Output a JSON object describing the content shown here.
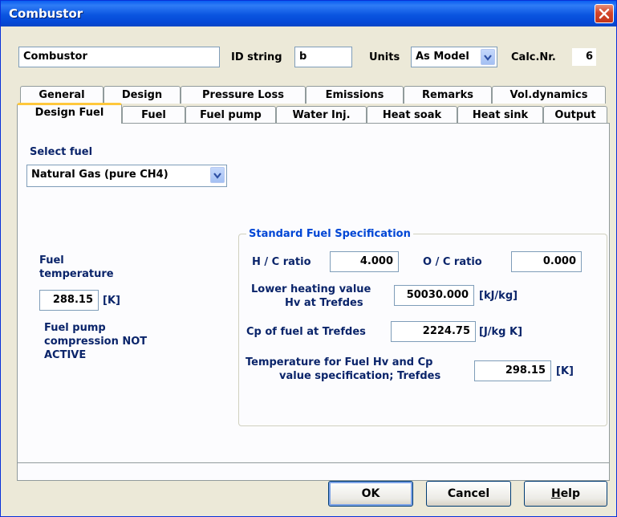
{
  "window": {
    "title": "Combustor"
  },
  "header": {
    "name_value": "Combustor",
    "id_label": "ID string",
    "id_value": "b",
    "units_label": "Units",
    "units_value": "As Model",
    "calc_label": "Calc.Nr.",
    "calc_value": "6"
  },
  "tabs_row1": [
    "General",
    "Design",
    "Pressure Loss",
    "Emissions",
    "Remarks",
    "Vol.dynamics"
  ],
  "tabs_row2": [
    "Design Fuel",
    "Fuel",
    "Fuel pump",
    "Water Inj.",
    "Heat soak",
    "Heat sink",
    "Output"
  ],
  "active_tab": "Design Fuel",
  "select_fuel": {
    "label": "Select fuel",
    "value": "Natural Gas (pure CH4)"
  },
  "fuel_temperature": {
    "label_line1": "Fuel",
    "label_line2": "temperature",
    "value": "288.15",
    "unit": "[K]"
  },
  "pump_status": {
    "line1": "Fuel pump",
    "line2": "compression  NOT",
    "line3": "ACTIVE"
  },
  "standard_spec": {
    "title": "Standard Fuel Specification",
    "hc_label": "H / C ratio",
    "hc_value": "4.000",
    "oc_label": "O / C ratio",
    "oc_value": "0.000",
    "lhv_label_line1": "Lower heating value",
    "lhv_label_line2": "Hv at Trefdes",
    "lhv_value": "50030.000",
    "lhv_unit": "[kJ/kg]",
    "cp_label": "Cp of fuel at Trefdes",
    "cp_value": "2224.75",
    "cp_unit": "[J/kg K]",
    "tref_label_line1": "Temperature for Fuel Hv and Cp",
    "tref_label_line2": "value specification; Trefdes",
    "tref_value": "298.15",
    "tref_unit": "[K]"
  },
  "buttons": {
    "ok": "OK",
    "cancel": "Cancel",
    "help_first": "H",
    "help_rest": "elp"
  },
  "colors": {
    "title_bar": "#0a55e0",
    "group_title": "#0046d5",
    "tab_highlight": "#ffc83c"
  }
}
